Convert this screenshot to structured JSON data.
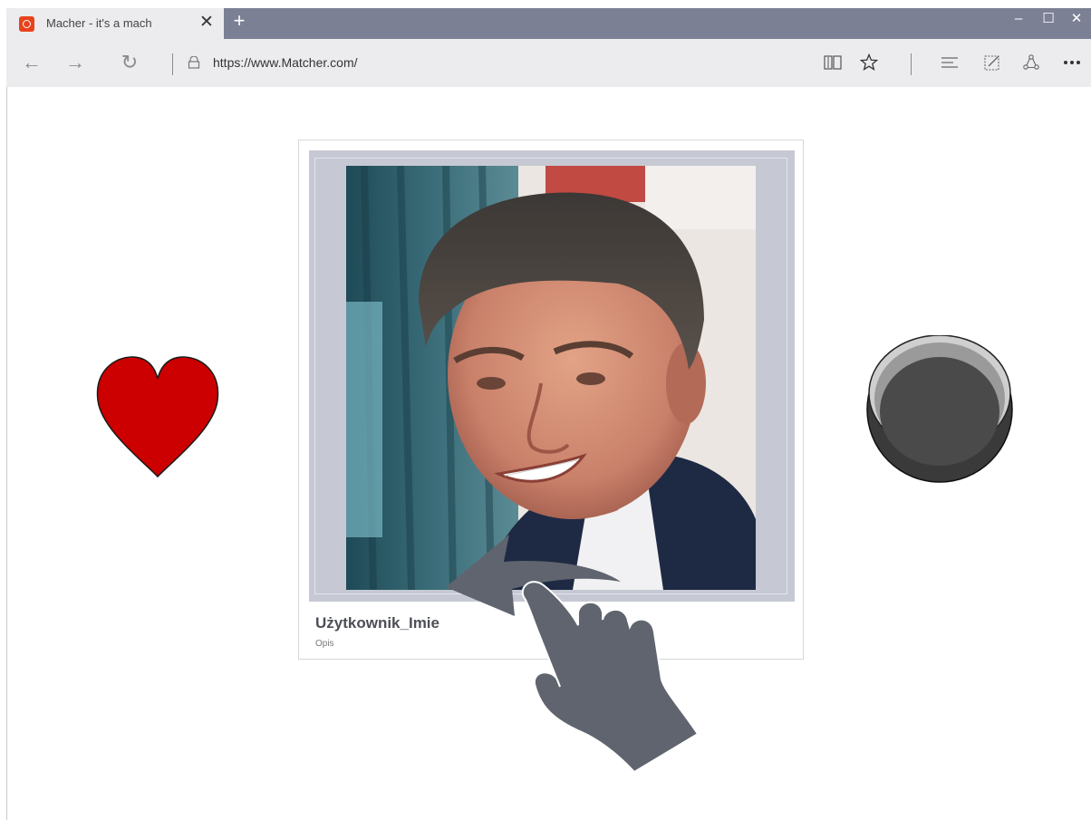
{
  "browser": {
    "tab": {
      "title": "Macher - it's a mach",
      "close_glyph": "✕",
      "favicon_color": "#e8431d"
    },
    "new_tab_glyph": "+",
    "window_controls": {
      "minimize": "–",
      "maximize": "☐",
      "close": "✕"
    },
    "nav": {
      "back_glyph": "←",
      "forward_glyph": "→",
      "refresh_glyph": "↻",
      "url": "https://www.Matcher.com/"
    },
    "toolbar_icons": [
      "reading-view-icon",
      "favorite-star-icon",
      "hub-icon",
      "web-note-icon",
      "share-icon",
      "more-icon"
    ],
    "colors": {
      "titlebar": "#7c8094",
      "tab": "#ececee",
      "navbar": "#ececee"
    }
  },
  "card": {
    "name": "Użytkownik_Imie",
    "description": "Opis",
    "frame_color": "#c6c9d3"
  },
  "actions": {
    "like_icon": "heart-icon",
    "like_color": "#cc0000",
    "dislike_icon": "dislike-circle-icon",
    "dislike_color": "#4a4a4a",
    "gesture_icon": "swipe-left-hand-icon",
    "gesture_color": "#5f646e"
  }
}
